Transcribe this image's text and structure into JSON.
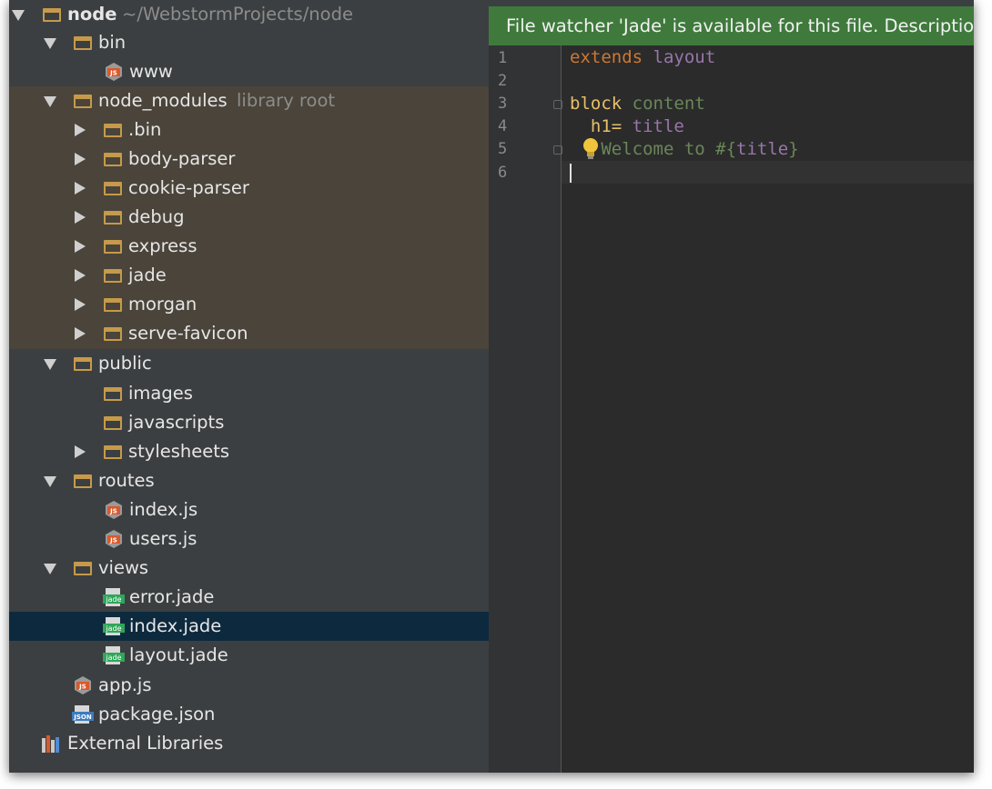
{
  "tree": {
    "project_name": "node",
    "project_path": "~/WebstormProjects/node",
    "bin": "bin",
    "www": "www",
    "node_modules": "node_modules",
    "library_root": "library root",
    "modules": [
      ".bin",
      "body-parser",
      "cookie-parser",
      "debug",
      "express",
      "jade",
      "morgan",
      "serve-favicon"
    ],
    "public": "public",
    "public_children": [
      "images",
      "javascripts",
      "stylesheets"
    ],
    "routes": "routes",
    "routes_children": [
      "index.js",
      "users.js"
    ],
    "views": "views",
    "views_children": [
      "error.jade",
      "index.jade",
      "layout.jade"
    ],
    "app_js": "app.js",
    "package_json": "package.json",
    "external_libraries": "External Libraries",
    "js_icon_text": "JS",
    "json_icon_text": "JSON",
    "jade_icon_text": "jade"
  },
  "editor": {
    "banner": "File watcher 'Jade' is available for this file. Description",
    "line_numbers": [
      "1",
      "2",
      "3",
      "4",
      "5",
      "6"
    ],
    "code": {
      "l1_kw": "extends",
      "l1_name": "layout",
      "l3_tag": "block",
      "l3_name": "content",
      "l4_tag": "h1=",
      "l4_name": "title",
      "l5_text": "Welcome to #{",
      "l5_name": "title",
      "l5_end": "}"
    }
  },
  "colors": {
    "tree_bg": "#3c3f41",
    "library_zone": "#4a443a",
    "selection": "#0d293e",
    "banner": "#3f7a3c",
    "folder": "#c69a4a",
    "editor_bg": "#2b2b2b"
  }
}
